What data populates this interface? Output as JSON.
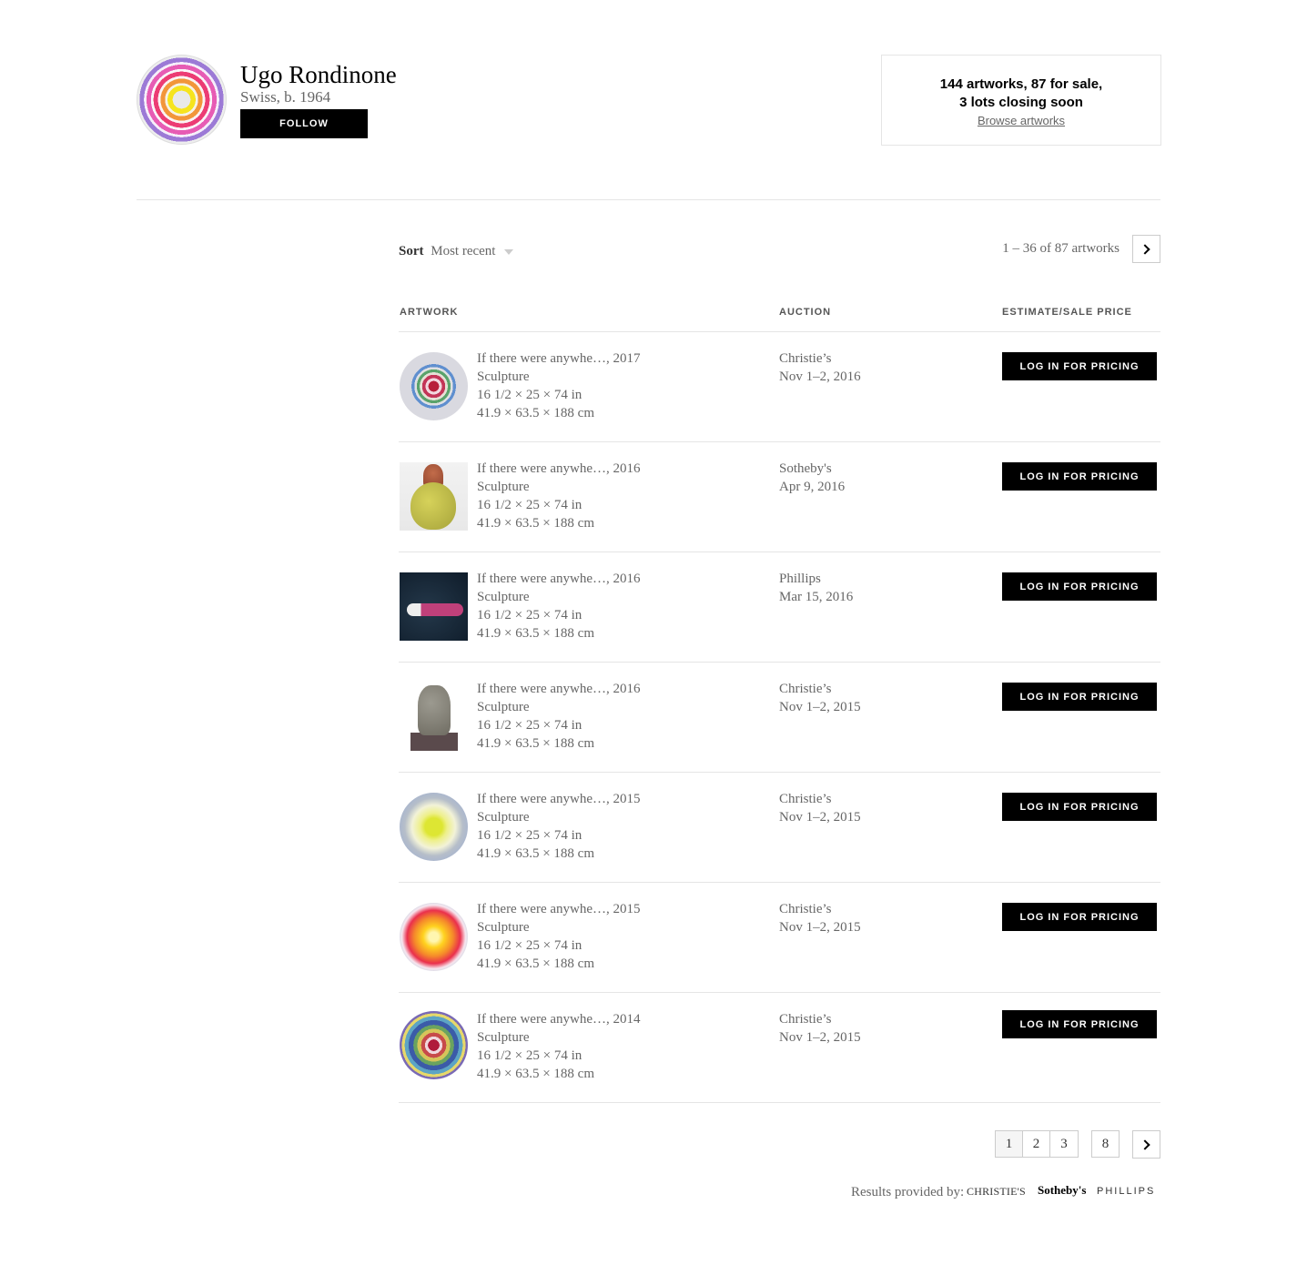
{
  "artist": {
    "name": "Ugo Rondinone",
    "bio": "Swiss, b. 1964",
    "follow_label": "FOLLOW"
  },
  "summary": {
    "line1": "144 artworks, 87 for sale,",
    "line2": "3 lots closing soon",
    "browse_label": "Browse artworks"
  },
  "sort": {
    "label": "Sort",
    "value": "Most recent"
  },
  "results": {
    "count_text": "1 – 36 of 87 artworks"
  },
  "table": {
    "headers": [
      "ARTWORK",
      "AUCTION",
      "ESTIMATE/SALE PRICE"
    ],
    "pricing_label": "LOG IN FOR PRICING",
    "rows": [
      {
        "thumb": "concentric-rings-red-green-blue",
        "title": "If there were anywhe…, 2017",
        "medium": "Sculpture",
        "size_in": "16 1/2 × 25 × 74 in",
        "size_cm": "41.9 × 63.5 × 188 cm",
        "house": "Christie’s",
        "date": "Nov 1–2, 2016"
      },
      {
        "thumb": "pear-sculpture",
        "title": "If there were anywhe…, 2016",
        "medium": "Sculpture",
        "size_in": "16 1/2 × 25 × 74 in",
        "size_cm": "41.9 × 63.5 × 188 cm",
        "house": "Sotheby's",
        "date": "Apr 9, 2016"
      },
      {
        "thumb": "reclining-figure",
        "title": "If there were anywhe…, 2016",
        "medium": "Sculpture",
        "size_in": "16 1/2 × 25 × 74 in",
        "size_cm": "41.9 × 63.5 × 188 cm",
        "house": "Phillips",
        "date": "Mar 15, 2016"
      },
      {
        "thumb": "stone-head",
        "title": "If there were anywhe…, 2016",
        "medium": "Sculpture",
        "size_in": "16 1/2 × 25 × 74 in",
        "size_cm": "41.9 × 63.5 × 188 cm",
        "house": "Christie’s",
        "date": "Nov 1–2, 2015"
      },
      {
        "thumb": "yellow-glow-circle",
        "title": "If there were anywhe…, 2015",
        "medium": "Sculpture",
        "size_in": "16 1/2 × 25 × 74 in",
        "size_cm": "41.9 × 63.5 × 188 cm",
        "house": "Christie’s",
        "date": "Nov 1–2, 2015"
      },
      {
        "thumb": "orange-glow-circle",
        "title": "If there were anywhe…, 2015",
        "medium": "Sculpture",
        "size_in": "16 1/2 × 25 × 74 in",
        "size_cm": "41.9 × 63.5 × 188 cm",
        "house": "Christie’s",
        "date": "Nov 1–2, 2015"
      },
      {
        "thumb": "concentric-rings-multicolor",
        "title": "If there were anywhe…, 2014",
        "medium": "Sculpture",
        "size_in": "16 1/2 × 25 × 74 in",
        "size_cm": "41.9 × 63.5 × 188 cm",
        "house": "Christie’s",
        "date": "Nov 1–2, 2015"
      }
    ]
  },
  "pagination": {
    "pages": [
      "1",
      "2",
      "3",
      "8"
    ],
    "current": "1"
  },
  "footer": {
    "label": "Results provided by:",
    "logos": [
      "CHRISTIE'S",
      "Sotheby's",
      "PHILLIPS"
    ]
  },
  "colors": {
    "button_bg": "#000000",
    "muted_text": "#666666",
    "rule": "#e5e5e5"
  }
}
